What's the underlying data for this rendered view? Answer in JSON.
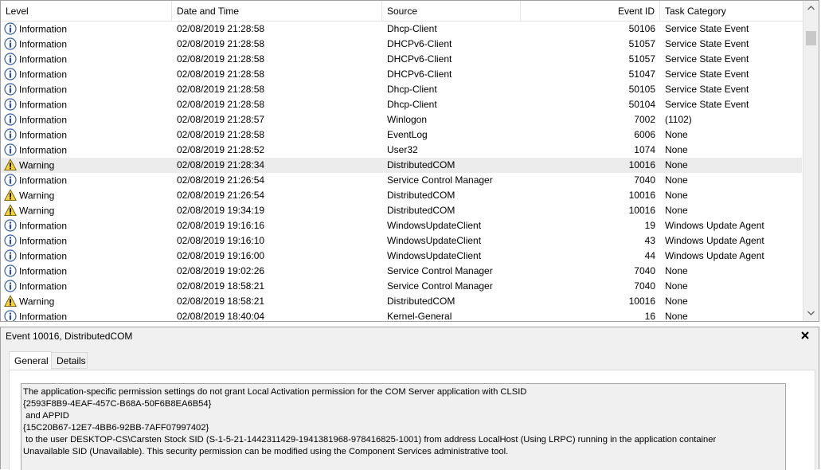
{
  "columns": {
    "level": "Level",
    "date": "Date and Time",
    "source": "Source",
    "event_id": "Event ID",
    "task": "Task Category"
  },
  "rows": [
    {
      "level": "Information",
      "date": "02/08/2019 21:28:58",
      "source": "Dhcp-Client",
      "event_id": "50106",
      "task": "Service State Event"
    },
    {
      "level": "Information",
      "date": "02/08/2019 21:28:58",
      "source": "DHCPv6-Client",
      "event_id": "51057",
      "task": "Service State Event"
    },
    {
      "level": "Information",
      "date": "02/08/2019 21:28:58",
      "source": "DHCPv6-Client",
      "event_id": "51057",
      "task": "Service State Event"
    },
    {
      "level": "Information",
      "date": "02/08/2019 21:28:58",
      "source": "DHCPv6-Client",
      "event_id": "51047",
      "task": "Service State Event"
    },
    {
      "level": "Information",
      "date": "02/08/2019 21:28:58",
      "source": "Dhcp-Client",
      "event_id": "50105",
      "task": "Service State Event"
    },
    {
      "level": "Information",
      "date": "02/08/2019 21:28:58",
      "source": "Dhcp-Client",
      "event_id": "50104",
      "task": "Service State Event"
    },
    {
      "level": "Information",
      "date": "02/08/2019 21:28:57",
      "source": "Winlogon",
      "event_id": "7002",
      "task": "(1102)"
    },
    {
      "level": "Information",
      "date": "02/08/2019 21:28:58",
      "source": "EventLog",
      "event_id": "6006",
      "task": "None"
    },
    {
      "level": "Information",
      "date": "02/08/2019 21:28:52",
      "source": "User32",
      "event_id": "1074",
      "task": "None"
    },
    {
      "level": "Warning",
      "date": "02/08/2019 21:28:34",
      "source": "DistributedCOM",
      "event_id": "10016",
      "task": "None",
      "selected": true
    },
    {
      "level": "Information",
      "date": "02/08/2019 21:26:54",
      "source": "Service Control Manager",
      "event_id": "7040",
      "task": "None"
    },
    {
      "level": "Warning",
      "date": "02/08/2019 21:26:54",
      "source": "DistributedCOM",
      "event_id": "10016",
      "task": "None"
    },
    {
      "level": "Warning",
      "date": "02/08/2019 19:34:19",
      "source": "DistributedCOM",
      "event_id": "10016",
      "task": "None"
    },
    {
      "level": "Information",
      "date": "02/08/2019 19:16:16",
      "source": "WindowsUpdateClient",
      "event_id": "19",
      "task": "Windows Update Agent"
    },
    {
      "level": "Information",
      "date": "02/08/2019 19:16:10",
      "source": "WindowsUpdateClient",
      "event_id": "43",
      "task": "Windows Update Agent"
    },
    {
      "level": "Information",
      "date": "02/08/2019 19:16:00",
      "source": "WindowsUpdateClient",
      "event_id": "44",
      "task": "Windows Update Agent"
    },
    {
      "level": "Information",
      "date": "02/08/2019 19:02:26",
      "source": "Service Control Manager",
      "event_id": "7040",
      "task": "None"
    },
    {
      "level": "Information",
      "date": "02/08/2019 18:58:21",
      "source": "Service Control Manager",
      "event_id": "7040",
      "task": "None"
    },
    {
      "level": "Warning",
      "date": "02/08/2019 18:58:21",
      "source": "DistributedCOM",
      "event_id": "10016",
      "task": "None"
    },
    {
      "level": "Information",
      "date": "02/08/2019 18:40:04",
      "source": "Kernel-General",
      "event_id": "16",
      "task": "None"
    }
  ],
  "detail": {
    "title": "Event 10016, DistributedCOM",
    "tabs": [
      "General",
      "Details"
    ],
    "description_lines": [
      "The application-specific permission settings do not grant Local Activation permission for the COM Server application with CLSID",
      "{2593F8B9-4EAF-457C-B68A-50F6B8EA6B54}",
      " and APPID",
      "{15C20B67-12E7-4BB6-92BB-7AFF07997402}",
      " to the user DESKTOP-CS\\Carsten Stock SID (S-1-5-21-1442311429-1941381968-978416825-1001) from address LocalHost (Using LRPC) running in the application container",
      "Unavailable SID (Unavailable). This security permission can be modified using the Component Services administrative tool."
    ]
  },
  "icons": {
    "information": "information-icon",
    "warning": "warning-icon",
    "close": "close-icon",
    "scroll_up": "chevron-up-icon",
    "scroll_down": "chevron-down-icon"
  },
  "colors": {
    "info_blue": "#2a5caa",
    "warning_yellow": "#f7d33a",
    "selected_row": "#ececec"
  }
}
